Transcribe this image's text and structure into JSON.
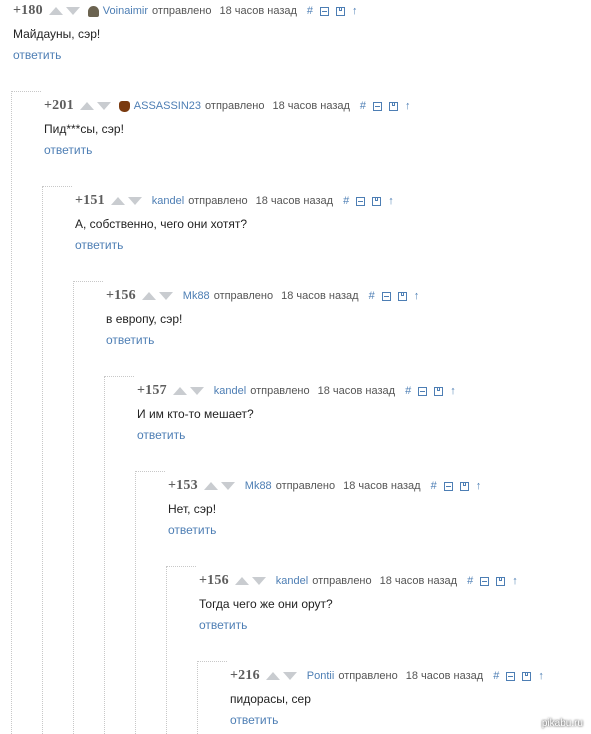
{
  "comments": [
    {
      "rating": "+180",
      "author": "Voinaimir",
      "avatar": "voin",
      "sent": "отправлено",
      "time": "18 часов назад",
      "text": "Майдауны, сэр!",
      "reply": "ответить"
    },
    {
      "rating": "+201",
      "author": "ASSASSIN23",
      "avatar": "assassin",
      "sent": "отправлено",
      "time": "18 часов назад",
      "text": "Пид***сы, сэр!",
      "reply": "ответить"
    },
    {
      "rating": "+151",
      "author": "kandel",
      "avatar": "",
      "sent": "отправлено",
      "time": "18 часов назад",
      "text": "А, собственно, чего они хотят?",
      "reply": "ответить"
    },
    {
      "rating": "+156",
      "author": "Mk88",
      "avatar": "",
      "sent": "отправлено",
      "time": "18 часов назад",
      "text": "в европу, сэр!",
      "reply": "ответить"
    },
    {
      "rating": "+157",
      "author": "kandel",
      "avatar": "",
      "sent": "отправлено",
      "time": "18 часов назад",
      "text": "И им кто-то мешает?",
      "reply": "ответить"
    },
    {
      "rating": "+153",
      "author": "Mk88",
      "avatar": "",
      "sent": "отправлено",
      "time": "18 часов назад",
      "text": "Нет, сэр!",
      "reply": "ответить"
    },
    {
      "rating": "+156",
      "author": "kandel",
      "avatar": "",
      "sent": "отправлено",
      "time": "18 часов назад",
      "text": "Тогда чего же они орут?",
      "reply": "ответить"
    },
    {
      "rating": "+216",
      "author": "Pontii",
      "avatar": "",
      "sent": "отправлено",
      "time": "18 часов назад",
      "text": "пидорасы, сер",
      "reply": "ответить"
    }
  ],
  "icons": {
    "hash": "#",
    "collapse": "collapse-icon",
    "save": "save-icon",
    "parent": "↑"
  },
  "watermark": "pikabu.ru",
  "colors": {
    "link": "#4d7eb4",
    "rating": "#5d5d5d",
    "vote": "#c9ccd0"
  }
}
